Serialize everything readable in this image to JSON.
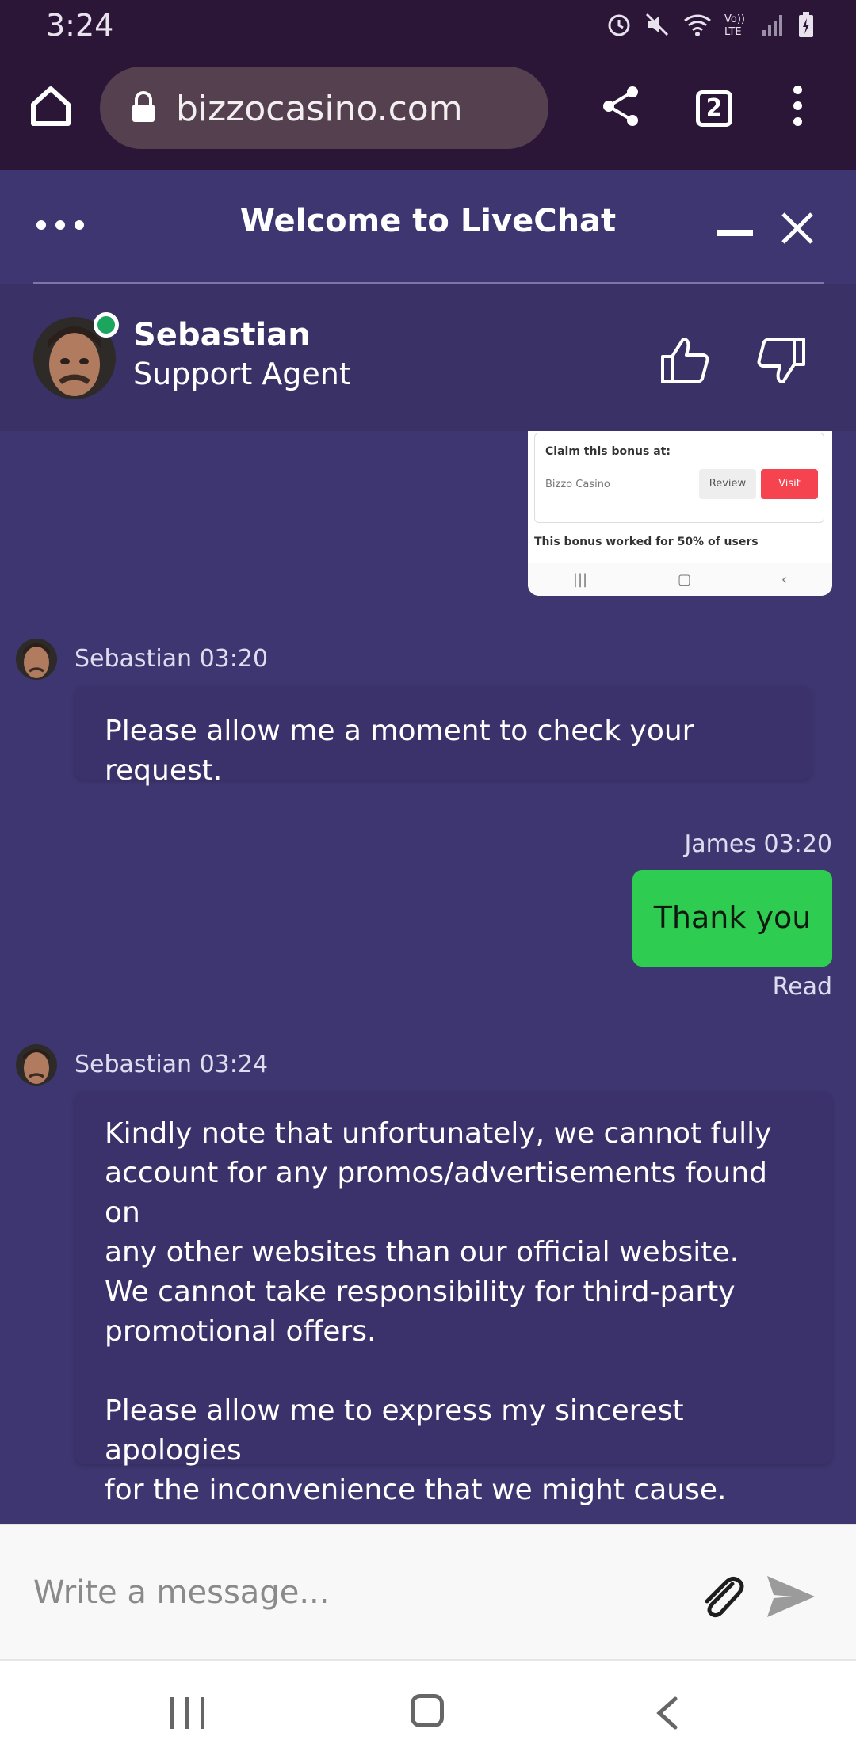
{
  "status_bar": {
    "time": "3:24"
  },
  "browser": {
    "url": "bizzocasino.com",
    "tab_count": "2"
  },
  "chat_header": {
    "title": "Welcome to LiveChat",
    "agent_name": "Sebastian",
    "agent_role": "Support Agent"
  },
  "shared_image": {
    "claim_label": "Claim this bonus at:",
    "casino": "Bizzo Casino",
    "review_label": "Review",
    "visit_label": "Visit",
    "footer_text": "This bonus worked for 50% of users"
  },
  "messages": [
    {
      "author": "Sebastian",
      "time": "03:20",
      "meta": "Sebastian 03:20",
      "text": "Please allow me a moment to check your request."
    },
    {
      "author": "James",
      "time": "03:20",
      "meta": "James 03:20",
      "text": "Thank you",
      "status": "Read"
    },
    {
      "author": "Sebastian",
      "time": "03:24",
      "meta": "Sebastian 03:24",
      "lines": [
        "Kindly note that unfortunately, we cannot fully",
        "account for any promos/advertisements found on",
        "any other websites than our official website.",
        "We cannot take responsibility for third-party",
        "promotional offers.",
        "",
        "Please allow me to express my sincerest apologies",
        "for the inconvenience that we might cause."
      ]
    }
  ],
  "composer": {
    "placeholder": "Write a message..."
  },
  "colors": {
    "panel": "#3e3670",
    "user_bubble": "#2fcc52",
    "online": "#1ca55f",
    "browser_bar": "#2c1638"
  }
}
